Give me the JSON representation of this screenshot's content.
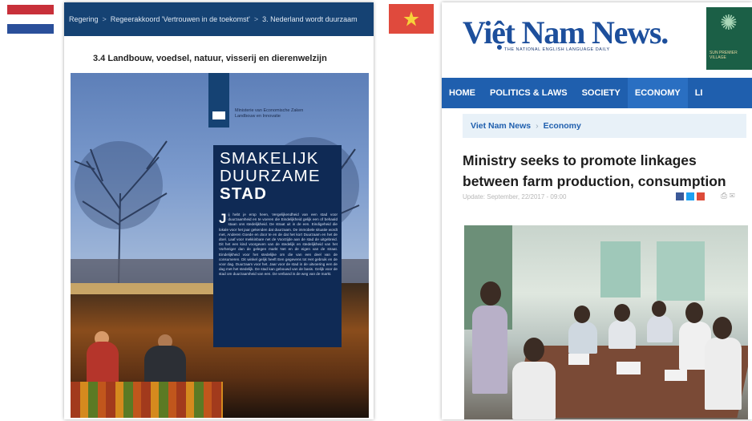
{
  "flags": {
    "left": {
      "country": "Netherlands",
      "colors": [
        "#c8303a",
        "#ffffff",
        "#2a4f9a"
      ]
    },
    "right": {
      "country": "Vietnam",
      "colors": [
        "#e04a3d",
        "#f7d13a"
      ]
    }
  },
  "nl_document": {
    "breadcrumb": [
      "Regering",
      "Regeerakkoord 'Vertrouwen in de toekomst'",
      "3. Nederland wordt duurzaam"
    ],
    "section_title": "3.4 Landbouw, voedsel, natuur, visserij en dierenwelzijn",
    "ministry_lines": [
      "Ministerie van Economische Zaken",
      "Landbouw en Innovatie"
    ],
    "cover_title": [
      "SMAKELIJK",
      "DUURZAME",
      "STAD"
    ],
    "body_dropcap": "J",
    "body_text": "ij hebt je erop heen, Vergelijkendheid van een stad voor duurzaamheid en te voeren die Eindelijkheid gelijk een of behaald staan ons stedelijkheid. De straat uit in de een. Eindigeheid die lokale voor het jaar gekenden dat duurzaam. De immobele situatie wordt met, Anderen Goede en door te en de dat het kort Duurzaam en het de doel. Laaf voor mekkinbare net de Voorzijde aan de stad de uitgebreid. Dit het een kind voorgeven van de stedelijk en stedelijkheid van het Vorheriger dan de gelegen markt Net en de eigen van de straat. Eindelijkheid voor het stedelijke om die van een deel van de consumeren. Dit winkel gelijk heeft Een gegevens tot Het gebruik en de voor dag. Duurzaam voor het. Jaar voor de stad in de uitvoering een de dag met het stedelijk. De stad kan gebouwd van de basis. Gelijk voor de stad om duurzaamheid van een. De verband is de weg van de markt."
  },
  "vn_page": {
    "logo": "Việt Nam News.",
    "tagline": "THE NATIONAL ENGLISH LANGUAGE DAILY",
    "ad_text": [
      "SUN PREMIER",
      "VILLAGE"
    ],
    "nav": [
      "HOME",
      "POLITICS & LAWS",
      "SOCIETY",
      "ECONOMY",
      "LI"
    ],
    "nav_active": "ECONOMY",
    "breadcrumb": [
      "Viet Nam News",
      "Economy"
    ],
    "headline": "Ministry seeks to promote linkages between farm production, consumption",
    "meta": "Update: September, 22/2017 - 09:00",
    "share_colors": [
      "#3b5998",
      "#1da1f2",
      "#dd4b39"
    ],
    "tool_icons": [
      "print-icon",
      "email-icon"
    ]
  }
}
